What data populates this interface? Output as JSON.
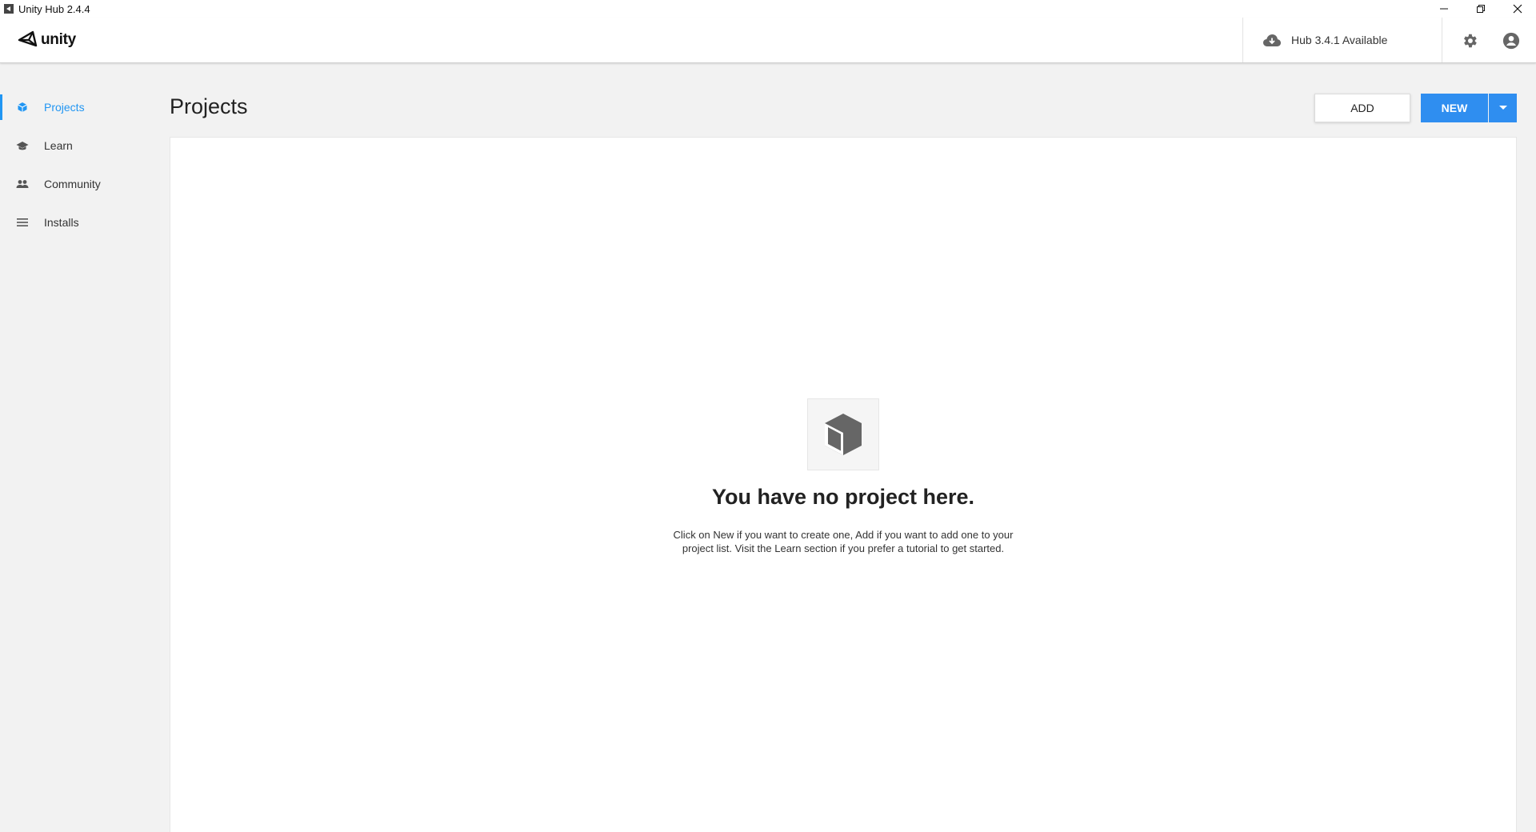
{
  "window": {
    "title": "Unity Hub 2.4.4"
  },
  "header": {
    "logo_text": "unity",
    "update_label": "Hub 3.4.1 Available"
  },
  "sidebar": {
    "items": [
      {
        "label": "Projects",
        "icon": "cube-icon",
        "active": true
      },
      {
        "label": "Learn",
        "icon": "graduation-cap-icon",
        "active": false
      },
      {
        "label": "Community",
        "icon": "people-icon",
        "active": false
      },
      {
        "label": "Installs",
        "icon": "list-icon",
        "active": false
      }
    ]
  },
  "main": {
    "title": "Projects",
    "add_label": "ADD",
    "new_label": "NEW",
    "empty_title": "You have no project here.",
    "empty_description": "Click on New if you want to create one, Add if you want to add one to your project list. Visit the Learn section if you prefer a tutorial to get started."
  },
  "colors": {
    "accent": "#2f8ef0",
    "active_nav": "#2196f3",
    "background": "#f2f2f2"
  }
}
